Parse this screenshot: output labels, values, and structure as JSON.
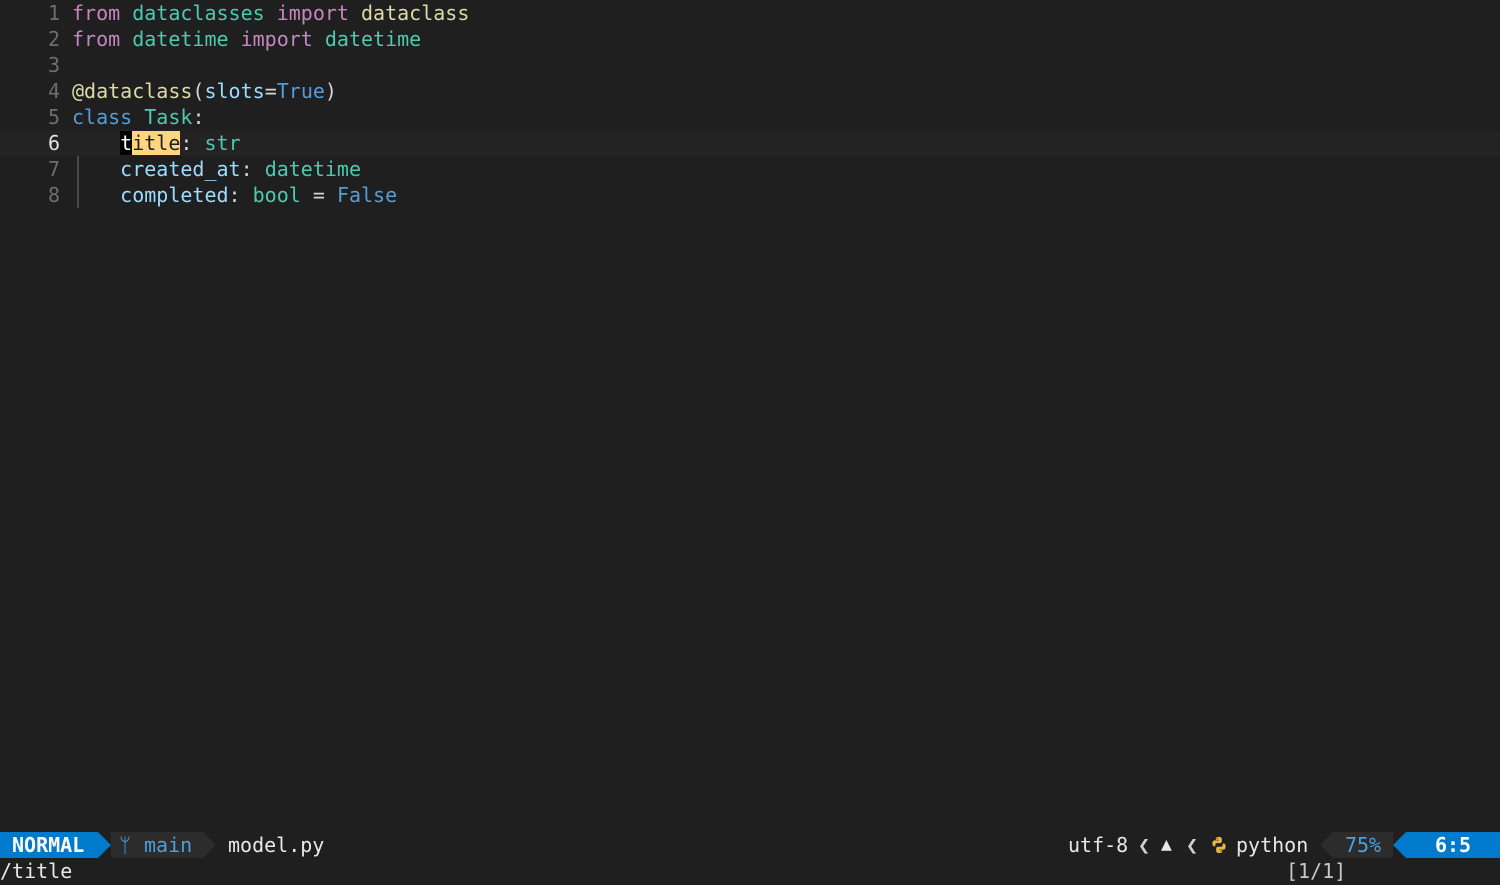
{
  "editor": {
    "lines": [
      {
        "num": "1",
        "tokens": [
          {
            "text": "from",
            "cls": "kw"
          },
          {
            "text": " ",
            "cls": "punc"
          },
          {
            "text": "dataclasses",
            "cls": "mod"
          },
          {
            "text": " ",
            "cls": "punc"
          },
          {
            "text": "import",
            "cls": "kw"
          },
          {
            "text": " ",
            "cls": "punc"
          },
          {
            "text": "dataclass",
            "cls": "fn"
          }
        ]
      },
      {
        "num": "2",
        "tokens": [
          {
            "text": "from",
            "cls": "kw"
          },
          {
            "text": " ",
            "cls": "punc"
          },
          {
            "text": "datetime",
            "cls": "mod"
          },
          {
            "text": " ",
            "cls": "punc"
          },
          {
            "text": "import",
            "cls": "kw"
          },
          {
            "text": " ",
            "cls": "punc"
          },
          {
            "text": "datetime",
            "cls": "mod"
          }
        ]
      },
      {
        "num": "3",
        "tokens": []
      },
      {
        "num": "4",
        "tokens": [
          {
            "text": "@dataclass",
            "cls": "dec"
          },
          {
            "text": "(",
            "cls": "punc"
          },
          {
            "text": "slots",
            "cls": "param"
          },
          {
            "text": "=",
            "cls": "punc"
          },
          {
            "text": "True",
            "cls": "const"
          },
          {
            "text": ")",
            "cls": "punc"
          }
        ]
      },
      {
        "num": "5",
        "tokens": [
          {
            "text": "class",
            "cls": "kwblue"
          },
          {
            "text": " ",
            "cls": "punc"
          },
          {
            "text": "Task",
            "cls": "cls"
          },
          {
            "text": ":",
            "cls": "punc"
          }
        ]
      },
      {
        "num": "6",
        "current": true,
        "tokens": [
          {
            "text": "    ",
            "cls": "punc"
          },
          {
            "text": "t",
            "cls": "cursor"
          },
          {
            "text": "itle",
            "cls": "match"
          },
          {
            "text": ": ",
            "cls": "punc"
          },
          {
            "text": "str",
            "cls": "type"
          }
        ]
      },
      {
        "num": "7",
        "tokens": [
          {
            "text": "    ",
            "cls": "punc"
          },
          {
            "text": "created_at",
            "cls": "attr"
          },
          {
            "text": ": ",
            "cls": "punc"
          },
          {
            "text": "datetime",
            "cls": "type"
          }
        ]
      },
      {
        "num": "8",
        "tokens": [
          {
            "text": "    ",
            "cls": "punc"
          },
          {
            "text": "completed",
            "cls": "attr"
          },
          {
            "text": ": ",
            "cls": "punc"
          },
          {
            "text": "bool",
            "cls": "type"
          },
          {
            "text": " = ",
            "cls": "punc"
          },
          {
            "text": "False",
            "cls": "const"
          }
        ]
      }
    ]
  },
  "statusline": {
    "mode": "NORMAL",
    "branch_icon": "git-branch-icon",
    "branch": "main",
    "filename": "model.py",
    "encoding": "utf-8",
    "separator": "❮",
    "os_icon": "linux-icon",
    "filetype_icon": "python-icon",
    "filetype": "python",
    "percent": "75%",
    "position": "6:5"
  },
  "cmdline": {
    "text": "/title",
    "search_count": "[1/1]"
  },
  "colors": {
    "accent": "#007acc",
    "background": "#1f1f1f",
    "search_match": "#ffd581"
  }
}
